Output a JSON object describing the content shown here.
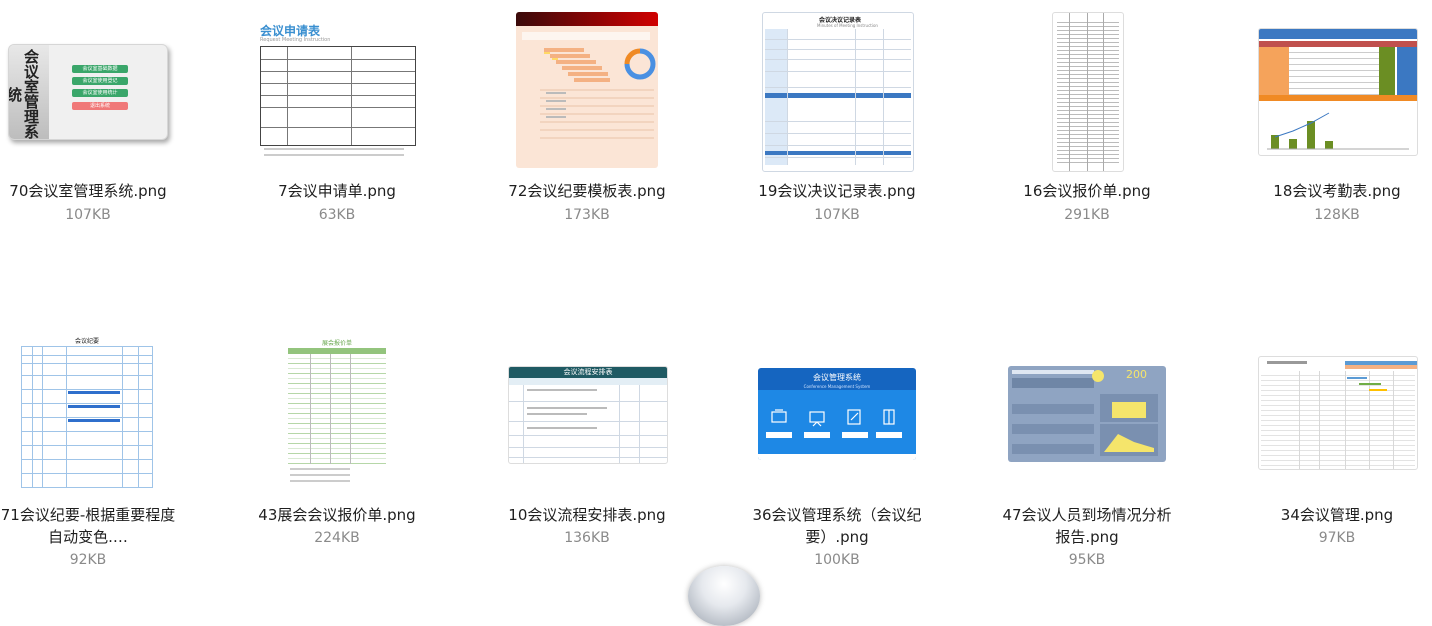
{
  "files": [
    {
      "name": "70会议室管理系统.png",
      "size": "107KB",
      "thumb_title": "会议室管理系统",
      "thumb_buttons": [
        "会议室基础数据",
        "会议室使用登记",
        "会议室使用统计",
        "退出系统"
      ]
    },
    {
      "name": "7会议申请单.png",
      "size": "63KB",
      "thumb_title": "会议申请表",
      "thumb_subtitle": "Request Meeting Instruction"
    },
    {
      "name": "72会议纪要模板表.png",
      "size": "173KB"
    },
    {
      "name": "19会议决议记录表.png",
      "size": "107KB",
      "thumb_title": "会议决议记录表",
      "thumb_subtitle": "Minutes of Meeting Instruction"
    },
    {
      "name": "16会议报价单.png",
      "size": "291KB"
    },
    {
      "name": "18会议考勤表.png",
      "size": "128KB"
    },
    {
      "name": "71会议纪要-根据重要程度自动变色.…",
      "name_line1": "71会议纪要-根据重要程度",
      "name_line2": "自动变色.…",
      "size": "92KB",
      "thumb_title": "会议纪要"
    },
    {
      "name": "43展会会议报价单.png",
      "size": "224KB",
      "thumb_title": "展会报价单"
    },
    {
      "name": "10会议流程安排表.png",
      "size": "136KB",
      "thumb_title": "会议流程安排表"
    },
    {
      "name": "36会议管理系统（会议纪要）.png",
      "name_line1": "36会议管理系统（会议纪",
      "name_line2": "要）.png",
      "size": "100KB",
      "thumb_title": "会议管理系统",
      "thumb_subtitle": "Conference Management System"
    },
    {
      "name": "47会议人员到场情况分析报告.png",
      "name_line1": "47会议人员到场情况分析",
      "name_line2": "报告.png",
      "size": "95KB",
      "thumb_number": "200"
    },
    {
      "name": "34会议管理.png",
      "size": "97KB"
    }
  ]
}
